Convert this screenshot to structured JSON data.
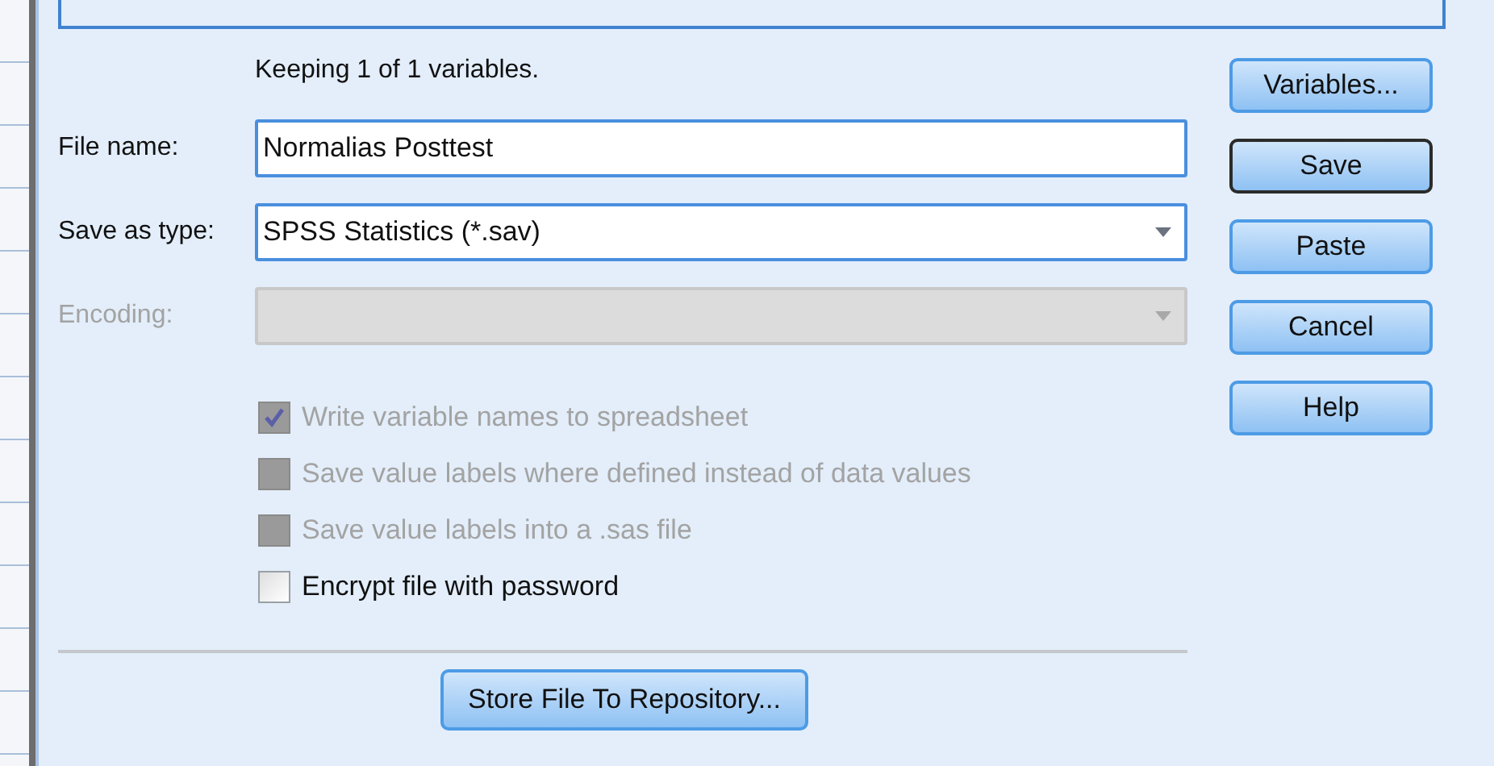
{
  "status_text": "Keeping 1 of 1 variables.",
  "fields": [
    {
      "kind": "text",
      "label": "File name:",
      "value": "Normalias Posttest",
      "disabled": false
    },
    {
      "kind": "dropdown",
      "label": "Save as type:",
      "value": "SPSS Statistics (*.sav)",
      "disabled": false
    },
    {
      "kind": "dropdown",
      "label": "Encoding:",
      "disabled": true
    }
  ],
  "options": [
    {
      "label": "Write variable names to spreadsheet",
      "checked": true,
      "disabled": true
    },
    {
      "label": "Save value labels where defined instead of data values",
      "checked": false,
      "disabled": true
    },
    {
      "label": "Save value labels into a .sas file",
      "checked": false,
      "disabled": true
    },
    {
      "label": "Encrypt file with password",
      "checked": false,
      "disabled": false
    }
  ],
  "buttons": [
    {
      "label": "Variables...",
      "default": false
    },
    {
      "label": "Save",
      "default": true
    },
    {
      "label": "Paste",
      "default": false
    },
    {
      "label": "Cancel",
      "default": false
    },
    {
      "label": "Help",
      "default": false
    }
  ],
  "repository_button": {
    "label": "Store File To Repository..."
  }
}
